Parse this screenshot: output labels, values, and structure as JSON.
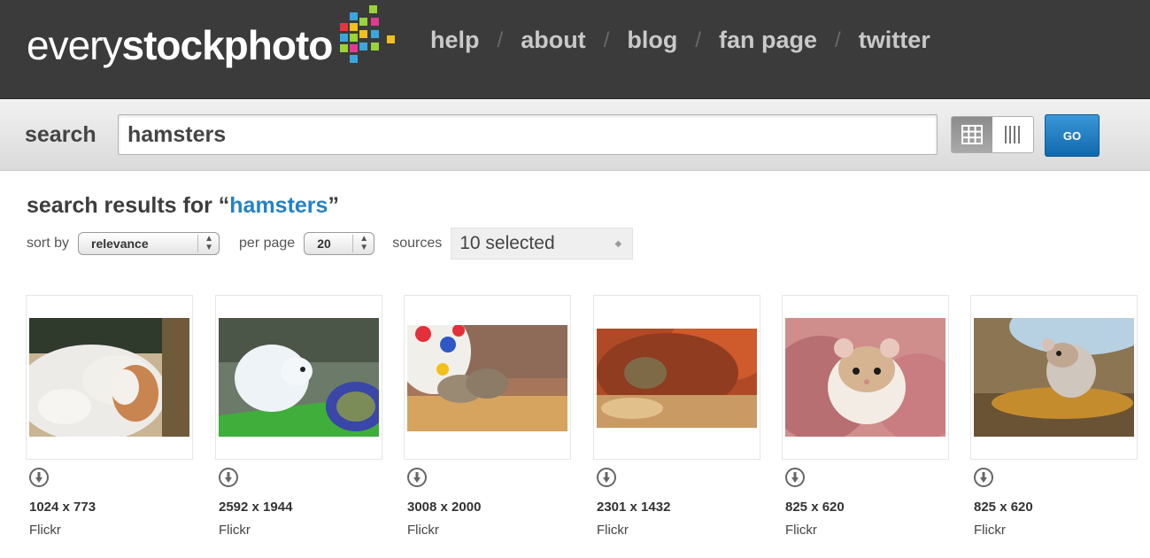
{
  "logo": {
    "light": "every",
    "bold": "stockphoto"
  },
  "nav": [
    "help",
    "about",
    "blog",
    "fan page",
    "twitter"
  ],
  "nav_separator": "/",
  "search": {
    "label": "search",
    "value": "hamsters",
    "go_label": "GO"
  },
  "results": {
    "title_prefix": "search results for “",
    "query": "hamsters",
    "title_suffix": "”"
  },
  "filters": {
    "sort_label": "sort by",
    "sort_value": "relevance",
    "per_page_label": "per page",
    "per_page_value": "20",
    "sources_label": "sources",
    "sources_value": "10 selected"
  },
  "photos": [
    {
      "dims": "1024 x 773",
      "source": "Flickr"
    },
    {
      "dims": "2592 x 1944",
      "source": "Flickr"
    },
    {
      "dims": "3008 x 2000",
      "source": "Flickr"
    },
    {
      "dims": "2301 x 1432",
      "source": "Flickr"
    },
    {
      "dims": "825 x 620",
      "source": "Flickr"
    },
    {
      "dims": "825 x 620",
      "source": "Flickr"
    }
  ],
  "colors": {
    "header": "#3b3b3b",
    "accent": "#2283c6",
    "go_button": "#1a78bf"
  },
  "icons": {
    "grid_view": "grid-view-icon",
    "column_view": "column-view-icon",
    "info": "info-icon"
  }
}
